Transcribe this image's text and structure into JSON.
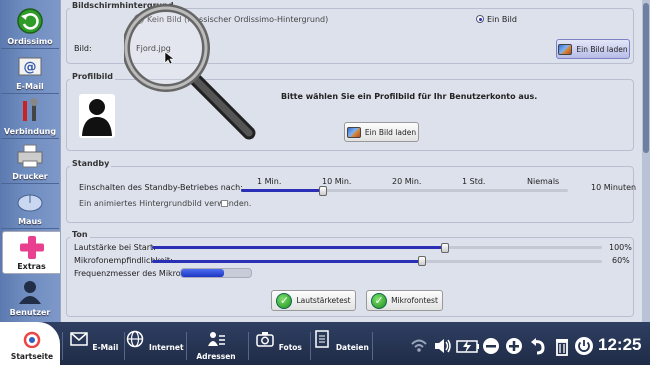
{
  "sidebar": {
    "items": [
      {
        "label": "Ordissimo"
      },
      {
        "label": "E-Mail"
      },
      {
        "label": "Verbindung"
      },
      {
        "label": "Drucker"
      },
      {
        "label": "Maus"
      },
      {
        "label": "Extras"
      },
      {
        "label": "Benutzer"
      }
    ]
  },
  "background": {
    "title": "Bildschirmhintergrund",
    "option_none": "Kein Bild (klassischer Ordissimo-Hintergrund)",
    "option_image": "Ein Bild",
    "field_label": "Bild:",
    "file_name": "Fjord.jpg",
    "load_button": "Ein Bild laden"
  },
  "profile": {
    "title": "Profilbild",
    "instruction": "Bitte wählen Sie ein Profilbild für Ihr Benutzerkonto aus.",
    "load_button": "Ein Bild laden"
  },
  "standby": {
    "title": "Standby",
    "slider_label": "Einschalten des Standby-Betriebes nach:",
    "ticks": [
      "1 Min.",
      "10 Min.",
      "20 Min.",
      "1 Std.",
      "Niemals"
    ],
    "value": "10 Minuten",
    "level": 0.25,
    "animated_label": "Ein animiertes Hintergrundbild verwenden."
  },
  "sound": {
    "title": "Ton",
    "volume_label": "Lautstärke bei Start:",
    "volume_value": "100%",
    "volume_level": 0.65,
    "mic_label": "Mikrofonempfindlichkeit:",
    "mic_value": "60%",
    "mic_level": 0.6,
    "meter_label": "Frequenzmesser des Mikrofons:",
    "meter_level": 0.6,
    "volume_test": "Lautstärketest",
    "mic_test": "Mikrofontest"
  },
  "taskbar": {
    "items": [
      {
        "label": "Startseite"
      },
      {
        "label": "E-Mail"
      },
      {
        "label": "Internet"
      },
      {
        "label": "Adressen"
      },
      {
        "label": "Fotos"
      },
      {
        "label": "Dateien"
      }
    ],
    "clock": "12:25"
  },
  "colors": {
    "accent": "#2a2fb5",
    "sidebar": "#6f8cc0",
    "taskbar": "#25334f"
  }
}
